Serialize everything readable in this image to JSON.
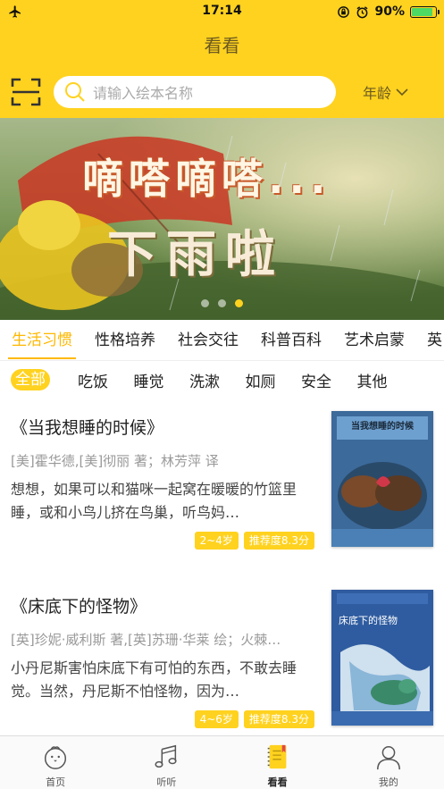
{
  "status_bar": {
    "time": "17:14",
    "battery_percent": "90%",
    "battery_level": 0.9
  },
  "header": {
    "title": "看看"
  },
  "search": {
    "placeholder": "请输入绘本名称",
    "age_filter_label": "年龄"
  },
  "banner": {
    "title_line_1": "嘀嗒嘀嗒...",
    "title_line_2": "下雨啦",
    "slide_count": 3,
    "active_slide": 3
  },
  "category_tabs": [
    {
      "label": "生活习惯",
      "active": true
    },
    {
      "label": "性格培养",
      "active": false
    },
    {
      "label": "社会交往",
      "active": false
    },
    {
      "label": "科普百科",
      "active": false
    },
    {
      "label": "艺术启蒙",
      "active": false
    },
    {
      "label": "英",
      "active": false
    }
  ],
  "sub_tabs": [
    {
      "label": "全部",
      "active": true
    },
    {
      "label": "吃饭",
      "active": false
    },
    {
      "label": "睡觉",
      "active": false
    },
    {
      "label": "洗漱",
      "active": false
    },
    {
      "label": "如厕",
      "active": false
    },
    {
      "label": "安全",
      "active": false
    },
    {
      "label": "其他",
      "active": false
    }
  ],
  "books": [
    {
      "title": "《当我想睡的时候》",
      "authors": "[美]霍华德,[美]彻丽 著；林芳萍 译",
      "description": "想想，如果可以和猫咪一起窝在暖暖的竹篮里睡，或和小鸟儿挤在鸟巢，听鸟妈…",
      "age": "2~4岁",
      "rating": "推荐度8.3分",
      "cover_title": "当我想睡的时候",
      "cover_color": "#3c6a9a"
    },
    {
      "title": "《床底下的怪物》",
      "authors": "[英]珍妮·威利斯 著,[英]苏珊·华莱 绘；火棘…",
      "description": "小丹尼斯害怕床底下有可怕的东西，不敢去睡觉。当然，丹尼斯不怕怪物，因为…",
      "age": "4~6岁",
      "rating": "推荐度8.3分",
      "cover_title": "床底下的怪物",
      "cover_color": "#2f5ca0"
    }
  ],
  "bottom_nav": [
    {
      "label": "首页",
      "icon": "chick-icon",
      "active": false
    },
    {
      "label": "听听",
      "icon": "music-note-icon",
      "active": false
    },
    {
      "label": "看看",
      "icon": "book-icon",
      "active": true
    },
    {
      "label": "我的",
      "icon": "person-icon",
      "active": false
    }
  ],
  "colors": {
    "brand_yellow": "#FFD21F",
    "accent_orange": "#FFB800"
  }
}
